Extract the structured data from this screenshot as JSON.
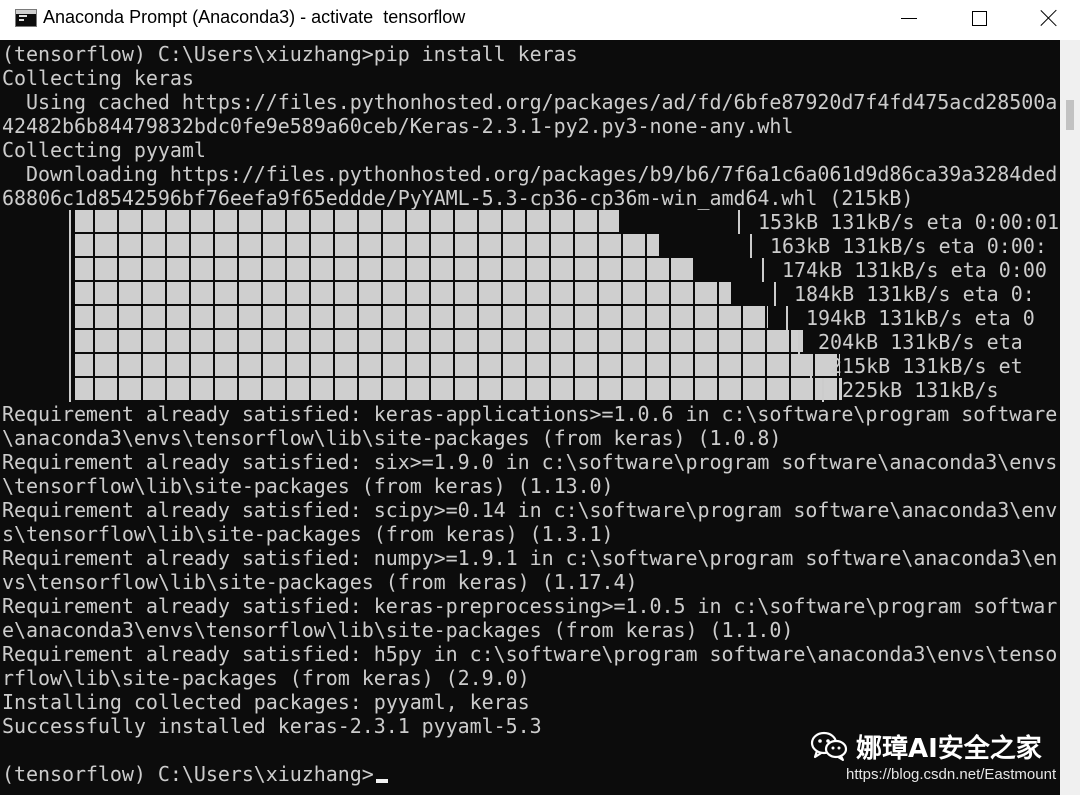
{
  "window": {
    "title": "Anaconda Prompt (Anaconda3) - activate  tensorflow"
  },
  "console": {
    "lines": [
      "(tensorflow) C:\\Users\\xiuzhang>pip install keras",
      "Collecting keras",
      "  Using cached https://files.pythonhosted.org/packages/ad/fd/6bfe87920d7f4fd475acd28500a",
      "42482b6b84479832bdc0fe9e589a60ceb/Keras-2.3.1-py2.py3-none-any.whl",
      "Collecting pyyaml",
      "  Downloading https://files.pythonhosted.org/packages/b9/b6/7f6a1c6a061d9d86ca39a3284ded",
      "68806c1d8542596bf76eefa9f65eddde/PyYAML-5.3-cp36-cp36m-win_amd64.whl (215kB)"
    ],
    "progress_rows": [
      {
        "fill": 0.712,
        "text": "153kB 131kB/s eta 0:00:01"
      },
      {
        "fill": 0.763,
        "text": "163kB 131kB/s eta 0:00:"
      },
      {
        "fill": 0.81,
        "text": "174kB 131kB/s eta 0:00"
      },
      {
        "fill": 0.857,
        "text": "184kB 131kB/s eta 0:"
      },
      {
        "fill": 0.904,
        "text": "194kB 131kB/s eta 0"
      },
      {
        "fill": 0.95,
        "text": "204kB 131kB/s eta"
      },
      {
        "fill": 0.998,
        "text": "215kB 131kB/s et"
      },
      {
        "fill": 1.0,
        "text": "225kB 131kB/s"
      }
    ],
    "lines_after": [
      "Requirement already satisfied: keras-applications>=1.0.6 in c:\\software\\program software",
      "\\anaconda3\\envs\\tensorflow\\lib\\site-packages (from keras) (1.0.8)",
      "Requirement already satisfied: six>=1.9.0 in c:\\software\\program software\\anaconda3\\envs",
      "\\tensorflow\\lib\\site-packages (from keras) (1.13.0)",
      "Requirement already satisfied: scipy>=0.14 in c:\\software\\program software\\anaconda3\\env",
      "s\\tensorflow\\lib\\site-packages (from keras) (1.3.1)",
      "Requirement already satisfied: numpy>=1.9.1 in c:\\software\\program software\\anaconda3\\en",
      "vs\\tensorflow\\lib\\site-packages (from keras) (1.17.4)",
      "Requirement already satisfied: keras-preprocessing>=1.0.5 in c:\\software\\program softwar",
      "e\\anaconda3\\envs\\tensorflow\\lib\\site-packages (from keras) (1.1.0)",
      "Requirement already satisfied: h5py in c:\\software\\program software\\anaconda3\\envs\\tenso",
      "rflow\\lib\\site-packages (from keras) (2.9.0)",
      "Installing collected packages: pyyaml, keras",
      "Successfully installed keras-2.3.1 pyyaml-5.3",
      "",
      "(tensorflow) C:\\Users\\xiuzhang>"
    ]
  },
  "watermark": {
    "title": "娜璋AI安全之家",
    "url": "https://blog.csdn.net/Eastmount"
  },
  "colors": {
    "console_bg": "#0c0c0c",
    "console_fg": "#cccccc",
    "progress_fill": "#cfcfcf"
  },
  "icons": {
    "app": "console-app-icon",
    "minimize": "minimize-icon",
    "maximize": "maximize-icon",
    "close": "close-icon",
    "watermark": "wechat-icon"
  }
}
